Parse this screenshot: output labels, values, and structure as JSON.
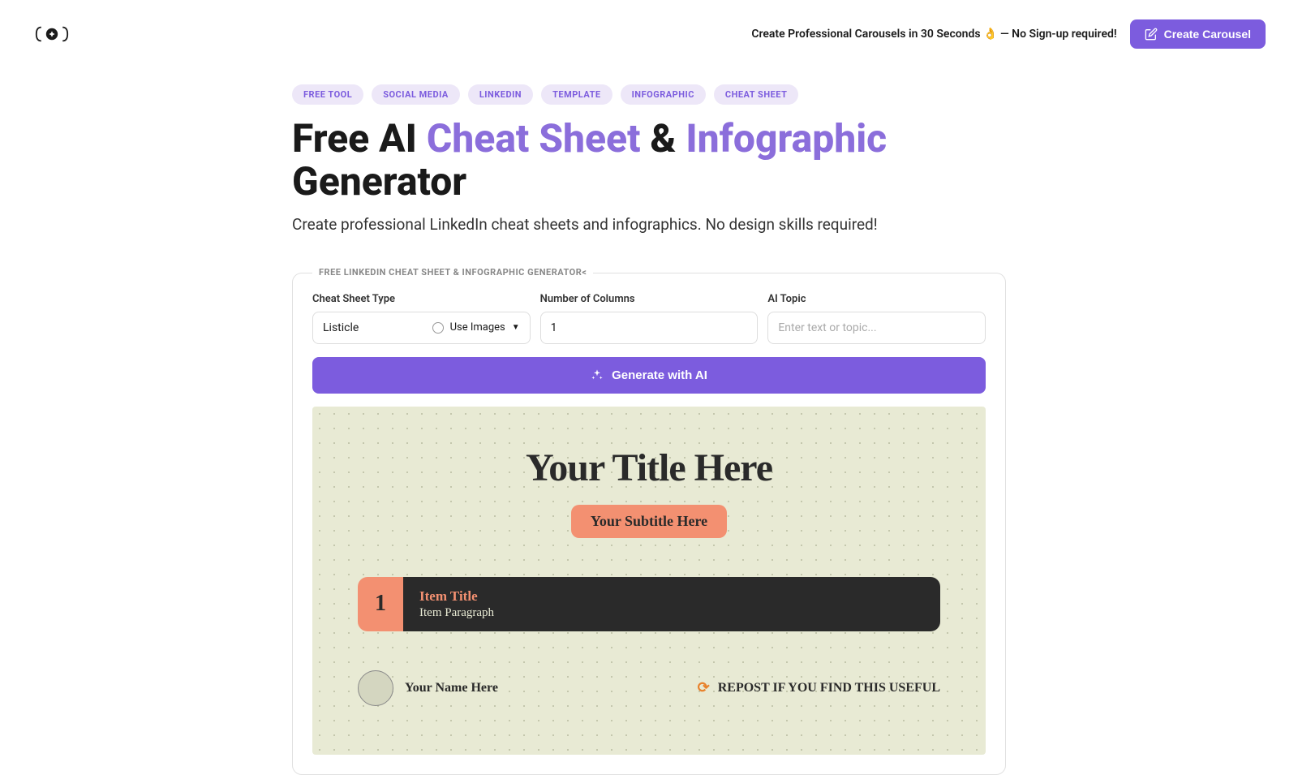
{
  "header": {
    "tagline": "Create Professional Carousels in 30 Seconds 👌 — No Sign-up required!",
    "cta": "Create Carousel"
  },
  "tags": [
    "FREE TOOL",
    "SOCIAL MEDIA",
    "LINKEDIN",
    "TEMPLATE",
    "INFOGRAPHIC",
    "CHEAT SHEET"
  ],
  "title": {
    "pre": "Free AI ",
    "accent1": "Cheat Sheet",
    "mid": " & ",
    "accent2": "Infographic",
    "post": " Generator"
  },
  "subtitle": "Create professional LinkedIn cheat sheets and infographics. No design skills required!",
  "form": {
    "box_label": "FREE LINKEDIN CHEAT SHEET & INFOGRAPHIC GENERATOR<",
    "type_label": "Cheat Sheet Type",
    "type_value": "Listicle",
    "use_images_label": "Use Images",
    "columns_label": "Number of Columns",
    "columns_value": "1",
    "topic_label": "AI Topic",
    "topic_placeholder": "Enter text or topic...",
    "generate_label": "Generate with AI"
  },
  "preview": {
    "title": "Your Title Here",
    "subtitle": "Your Subtitle Here",
    "item_num": "1",
    "item_title": "Item Title",
    "item_paragraph": "Item Paragraph",
    "author_name": "Your Name Here",
    "repost_text": "REPOST IF YOU FIND THIS USEFUL"
  }
}
